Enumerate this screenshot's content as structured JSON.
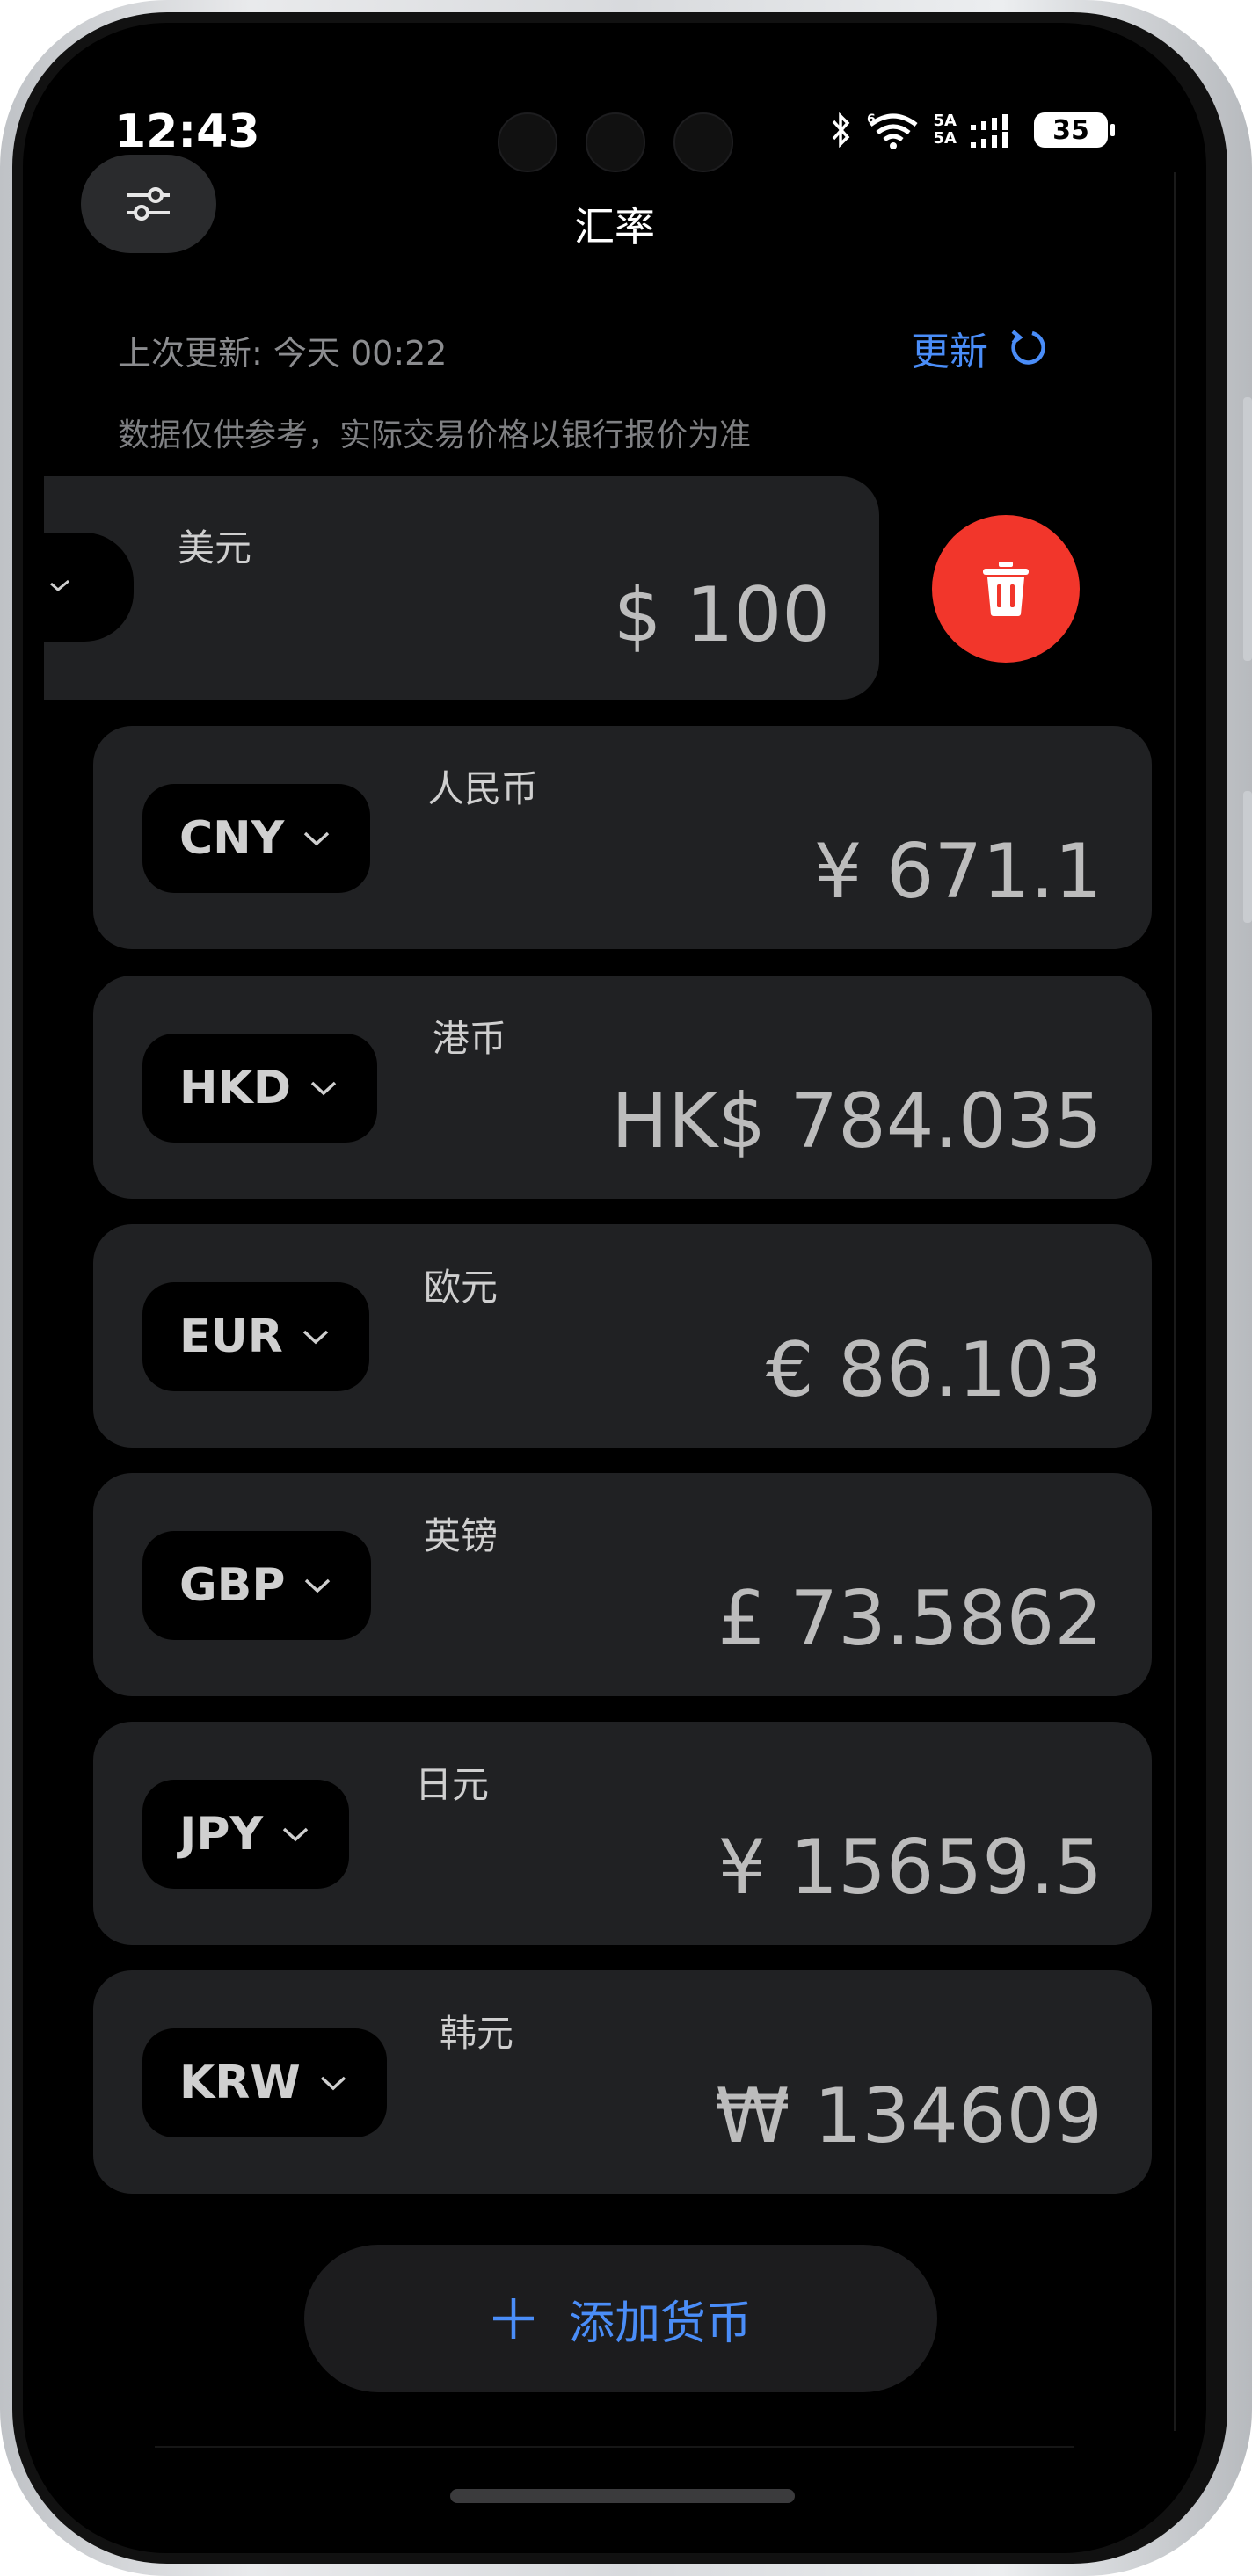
{
  "status_bar": {
    "time": "12:43",
    "signal_top": "5A",
    "signal_bottom": "5A",
    "wifi_label": "6",
    "battery": "35"
  },
  "header": {
    "title": "汇率",
    "settings_icon": "sliders-icon"
  },
  "info": {
    "last_update": "上次更新: 今天 00:22",
    "refresh_label": "更新",
    "disclaimer": "数据仅供参考，实际交易价格以银行报价为准"
  },
  "base_currency": {
    "name": "美元",
    "amount": "$ 100",
    "delete_icon": "trash-icon"
  },
  "currencies": [
    {
      "code": "CNY",
      "name": "人民币",
      "amount": "¥ 671.1"
    },
    {
      "code": "HKD",
      "name": "港币",
      "amount": "HK$ 784.035"
    },
    {
      "code": "EUR",
      "name": "欧元",
      "amount": "€ 86.103"
    },
    {
      "code": "GBP",
      "name": "英镑",
      "amount": "£ 73.5862"
    },
    {
      "code": "JPY",
      "name": "日元",
      "amount": "¥ 15659.5"
    },
    {
      "code": "KRW",
      "name": "韩元",
      "amount": "₩ 134609"
    }
  ],
  "add_button": {
    "label": "添加货币",
    "icon": "plus-icon"
  },
  "colors": {
    "accent": "#4a8df8",
    "delete": "#f2362b",
    "card": "#202123"
  }
}
